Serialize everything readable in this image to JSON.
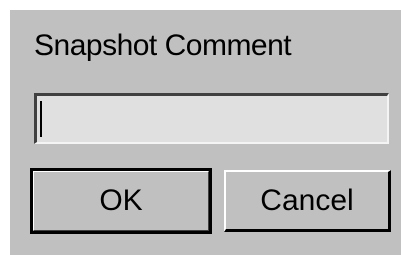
{
  "dialog": {
    "title": "Snapshot Comment",
    "comment_input": {
      "value": "",
      "placeholder": ""
    },
    "ok_label": "OK",
    "cancel_label": "Cancel"
  },
  "colors": {
    "dialog_background": "#c0c0c0",
    "input_background": "#e0e0e0",
    "text": "#000000"
  }
}
